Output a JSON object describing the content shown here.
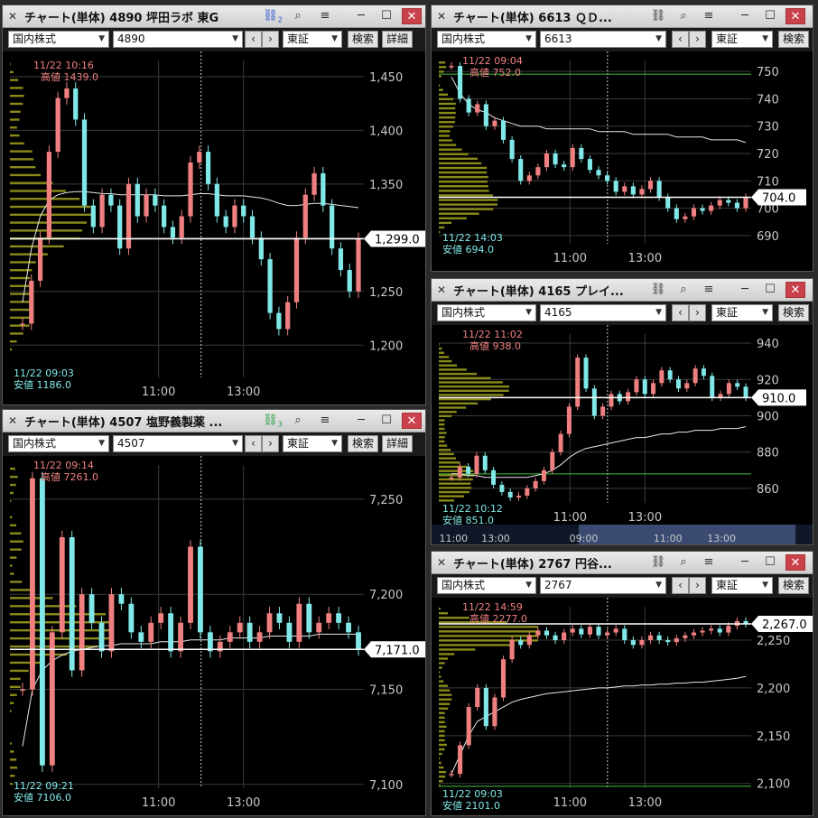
{
  "colors": {
    "bg": "#000000",
    "grid": "#3a3a3a",
    "candle_up": "#f08080",
    "candle_down": "#80e8e8",
    "vwap": "#e8e8e8",
    "volume_profile": "#8a8a1a",
    "high_text": "#f08080",
    "low_text": "#80e8e8",
    "axis_text": "#c8c8c8",
    "green_line": "#40c040"
  },
  "windows": [
    {
      "id": "w1",
      "title": "チャート(単体) 4890 坪田ラボ 東G",
      "link_icon": "link-blue-icon",
      "link_badge": "2",
      "market": "国内株式",
      "code": "4890",
      "exchange": "東証",
      "search_label": "検索",
      "detail_label": "詳細",
      "nav_prev": "‹",
      "nav_next": "›",
      "high_label_time": "11/22 10:16",
      "high_label": "高値 1439.0",
      "low_label_time": "11/22 09:03",
      "low_label": "安値 1186.0",
      "current_price": "1,299.0",
      "y_ticks": [
        "1,450",
        "1,400",
        "1,350",
        "1,300",
        "1,250",
        "1,200"
      ],
      "x_ticks": [
        "11:00",
        "13:00"
      ]
    },
    {
      "id": "w2",
      "title": "チャート(単体) 6613 ＱＤ...",
      "link_icon": "link-icon",
      "market": "国内株式",
      "code": "6613",
      "exchange": "東証",
      "search_label": "検索",
      "nav_prev": "‹",
      "nav_next": "›",
      "high_label_time": "11/22 09:04",
      "high_label": "高値 752.0",
      "low_label_time": "11/22 14:03",
      "low_label": "安値 694.0",
      "current_price": "704.0",
      "y_ticks": [
        "750",
        "740",
        "730",
        "720",
        "710",
        "700",
        "690"
      ],
      "x_ticks": [
        "11:00",
        "13:00"
      ]
    },
    {
      "id": "w3",
      "title": "チャート(単体) 4165 プレイ...",
      "link_icon": "link-icon",
      "market": "国内株式",
      "code": "4165",
      "exchange": "東証",
      "search_label": "検索",
      "nav_prev": "‹",
      "nav_next": "›",
      "high_label_time": "11/22 11:02",
      "high_label": "高値 938.0",
      "low_label_time": "11/22 10:12",
      "low_label": "安値 851.0",
      "current_price": "910.0",
      "y_ticks": [
        "940",
        "920",
        "900",
        "880",
        "860"
      ],
      "x_ticks": [
        "11:00",
        "13:00"
      ],
      "overview_ticks": [
        "11:00",
        "13:00",
        "09:00",
        "11:00",
        "13:00"
      ]
    },
    {
      "id": "w4",
      "title": "チャート(単体) 4507 塩野義製薬 ...",
      "link_icon": "link-green-icon",
      "link_badge": "3",
      "market": "国内株式",
      "code": "4507",
      "exchange": "東証",
      "search_label": "検索",
      "detail_label": "詳細",
      "nav_prev": "‹",
      "nav_next": "›",
      "high_label_time": "11/22 09:14",
      "high_label": "高値 7261.0",
      "low_label_time": "11/22 09:21",
      "low_label": "安値 7106.0",
      "current_price": "7,171.0",
      "y_ticks": [
        "7,250",
        "7,200",
        "7,150",
        "7,100"
      ],
      "x_ticks": [
        "11:00",
        "13:00"
      ]
    },
    {
      "id": "w5",
      "title": "チャート(単体) 2767 円谷...",
      "link_icon": "link-icon",
      "market": "国内株式",
      "code": "2767",
      "exchange": "東証",
      "search_label": "検索",
      "nav_prev": "‹",
      "nav_next": "›",
      "high_label_time": "11/22 14:59",
      "high_label": "高値 2277.0",
      "low_label_time": "11/22 09:03",
      "low_label": "安値 2101.0",
      "current_price": "2,267.0",
      "y_ticks": [
        "2,250",
        "2,200",
        "2,150",
        "2,100"
      ],
      "x_ticks": [
        "11:00",
        "13:00"
      ]
    }
  ],
  "chart_data": [
    {
      "type": "line",
      "window": "w1",
      "title": "4890 坪田ラボ",
      "ylim": [
        1170,
        1465
      ],
      "series": [
        {
          "name": "price",
          "values": [
            1220,
            1260,
            1300,
            1380,
            1430,
            1439,
            1410,
            1330,
            1310,
            1340,
            1330,
            1290,
            1350,
            1320,
            1340,
            1330,
            1310,
            1300,
            1320,
            1370,
            1380,
            1350,
            1320,
            1310,
            1330,
            1320,
            1300,
            1280,
            1230,
            1215,
            1240,
            1300,
            1340,
            1360,
            1330,
            1290,
            1270,
            1250,
            1299
          ]
        },
        {
          "name": "vwap",
          "values": [
            1240,
            1290,
            1320,
            1335,
            1340,
            1342,
            1343,
            1343,
            1342,
            1341,
            1341,
            1340,
            1340,
            1340,
            1340,
            1340,
            1339,
            1339,
            1339,
            1340,
            1341,
            1341,
            1340,
            1339,
            1339,
            1339,
            1338,
            1337,
            1335,
            1332,
            1330,
            1330,
            1331,
            1332,
            1332,
            1331,
            1330,
            1329,
            1328
          ]
        }
      ],
      "current": 1299,
      "high": 1439,
      "low": 1186
    },
    {
      "type": "line",
      "window": "w2",
      "title": "6613 ＱＤ",
      "ylim": [
        687,
        754
      ],
      "series": [
        {
          "name": "price",
          "values": [
            752,
            740,
            735,
            738,
            730,
            732,
            725,
            718,
            710,
            712,
            715,
            720,
            716,
            715,
            722,
            718,
            714,
            712,
            710,
            706,
            708,
            705,
            707,
            710,
            704,
            700,
            696,
            697,
            700,
            699,
            701,
            703,
            702,
            700,
            704
          ]
        },
        {
          "name": "vwap",
          "values": [
            748,
            742,
            738,
            736,
            735,
            733,
            732,
            731,
            730,
            730,
            730,
            729,
            729,
            729,
            729,
            729,
            729,
            728,
            728,
            728,
            728,
            727,
            727,
            727,
            727,
            727,
            726,
            726,
            726,
            726,
            725,
            725,
            725,
            725,
            724
          ]
        }
      ],
      "current": 704,
      "high": 752,
      "low": 694
    },
    {
      "type": "line",
      "window": "w3",
      "title": "4165 プレイ",
      "ylim": [
        852,
        945
      ],
      "series": [
        {
          "name": "price",
          "values": [
            866,
            872,
            868,
            878,
            870,
            862,
            858,
            855,
            856,
            860,
            864,
            870,
            880,
            890,
            905,
            932,
            915,
            900,
            905,
            912,
            908,
            913,
            920,
            912,
            918,
            925,
            920,
            915,
            918,
            926,
            922,
            910,
            912,
            918,
            916,
            910
          ]
        },
        {
          "name": "vwap",
          "values": [
            868,
            868,
            867,
            867,
            866,
            866,
            866,
            866,
            866,
            866,
            867,
            868,
            870,
            873,
            877,
            880,
            882,
            883,
            884,
            885,
            886,
            887,
            888,
            888,
            889,
            890,
            890,
            891,
            891,
            892,
            892,
            892,
            893,
            893,
            893,
            894
          ]
        }
      ],
      "current": 910,
      "high": 938,
      "low": 851
    },
    {
      "type": "line",
      "window": "w4",
      "title": "4507 塩野義製薬",
      "ylim": [
        7098,
        7268
      ],
      "series": [
        {
          "name": "price",
          "values": [
            7150,
            7261,
            7110,
            7180,
            7230,
            7160,
            7200,
            7185,
            7170,
            7200,
            7195,
            7180,
            7175,
            7185,
            7190,
            7170,
            7185,
            7225,
            7180,
            7170,
            7175,
            7180,
            7185,
            7175,
            7180,
            7190,
            7185,
            7175,
            7195,
            7180,
            7185,
            7190,
            7185,
            7180,
            7171
          ]
        },
        {
          "name": "vwap",
          "values": [
            7120,
            7150,
            7160,
            7165,
            7168,
            7170,
            7171,
            7172,
            7173,
            7173,
            7174,
            7174,
            7174,
            7174,
            7175,
            7175,
            7175,
            7176,
            7176,
            7176,
            7176,
            7177,
            7177,
            7177,
            7177,
            7178,
            7178,
            7178,
            7178,
            7178,
            7179,
            7179,
            7179,
            7179,
            7179
          ]
        }
      ],
      "current": 7171,
      "high": 7261,
      "low": 7106
    },
    {
      "type": "line",
      "window": "w5",
      "title": "2767 円谷",
      "ylim": [
        2095,
        2285
      ],
      "series": [
        {
          "name": "price",
          "values": [
            2110,
            2140,
            2180,
            2200,
            2160,
            2190,
            2230,
            2250,
            2245,
            2255,
            2260,
            2255,
            2250,
            2258,
            2262,
            2256,
            2264,
            2255,
            2258,
            2262,
            2250,
            2245,
            2250,
            2255,
            2250,
            2248,
            2252,
            2255,
            2258,
            2260,
            2262,
            2258,
            2265,
            2270,
            2267
          ]
        },
        {
          "name": "vwap",
          "values": [
            2110,
            2130,
            2150,
            2165,
            2170,
            2175,
            2180,
            2185,
            2188,
            2190,
            2192,
            2194,
            2195,
            2196,
            2197,
            2198,
            2199,
            2200,
            2200,
            2201,
            2202,
            2202,
            2203,
            2203,
            2204,
            2204,
            2205,
            2205,
            2206,
            2206,
            2207,
            2208,
            2209,
            2210,
            2212
          ]
        }
      ],
      "current": 2267,
      "high": 2277,
      "low": 2101
    }
  ]
}
